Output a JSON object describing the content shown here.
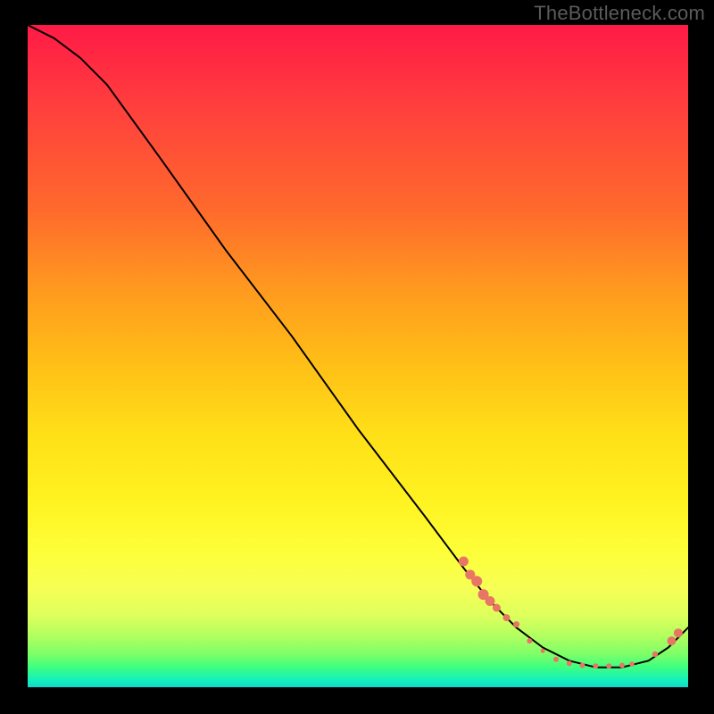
{
  "watermark": "TheBottleneck.com",
  "chart_data": {
    "type": "line",
    "title": "",
    "xlabel": "",
    "ylabel": "",
    "xlim": [
      0,
      100
    ],
    "ylim": [
      0,
      100
    ],
    "series": [
      {
        "name": "curve",
        "x": [
          0,
          4,
          8,
          12,
          20,
          30,
          40,
          50,
          60,
          66,
          70,
          74,
          78,
          82,
          86,
          90,
          94,
          97,
          100
        ],
        "y": [
          100,
          98,
          95,
          91,
          80,
          66,
          53,
          39,
          26,
          18,
          13,
          9,
          6,
          4,
          3,
          3,
          4,
          6,
          9
        ]
      }
    ],
    "markers": [
      {
        "name": "cluster-descent-a",
        "x": 66,
        "y": 19,
        "r": 5.5
      },
      {
        "name": "cluster-descent-b",
        "x": 67,
        "y": 17,
        "r": 5.5
      },
      {
        "name": "cluster-descent-c",
        "x": 68,
        "y": 16,
        "r": 6
      },
      {
        "name": "cluster-descent-d",
        "x": 69,
        "y": 14,
        "r": 6
      },
      {
        "name": "cluster-descent-e",
        "x": 70,
        "y": 13,
        "r": 5.5
      },
      {
        "name": "cluster-descent-f",
        "x": 71,
        "y": 12,
        "r": 4.5
      },
      {
        "name": "cluster-descent-g",
        "x": 72.5,
        "y": 10.5,
        "r": 4
      },
      {
        "name": "cluster-descent-h",
        "x": 74,
        "y": 9.5,
        "r": 3.5
      },
      {
        "name": "valley-a",
        "x": 76,
        "y": 7,
        "r": 3
      },
      {
        "name": "valley-b",
        "x": 78,
        "y": 5.5,
        "r": 2.5
      },
      {
        "name": "valley-floor-1",
        "x": 80,
        "y": 4.2,
        "r": 3
      },
      {
        "name": "valley-floor-2",
        "x": 82,
        "y": 3.6,
        "r": 3
      },
      {
        "name": "valley-floor-3",
        "x": 84,
        "y": 3.3,
        "r": 3
      },
      {
        "name": "valley-floor-4",
        "x": 86,
        "y": 3.2,
        "r": 3
      },
      {
        "name": "valley-floor-5",
        "x": 88,
        "y": 3.2,
        "r": 3
      },
      {
        "name": "valley-floor-6",
        "x": 90,
        "y": 3.3,
        "r": 3
      },
      {
        "name": "valley-floor-7",
        "x": 91.5,
        "y": 3.5,
        "r": 2.8
      },
      {
        "name": "rise-a",
        "x": 95,
        "y": 5,
        "r": 3.2
      },
      {
        "name": "rise-b",
        "x": 97.5,
        "y": 7,
        "r": 5
      },
      {
        "name": "rise-c",
        "x": 98.5,
        "y": 8.2,
        "r": 5
      }
    ],
    "colors": {
      "line": "#000000",
      "markers": "#e97565",
      "gradient_top": "#ff1a46",
      "gradient_bottom": "#0fd9c9"
    }
  }
}
